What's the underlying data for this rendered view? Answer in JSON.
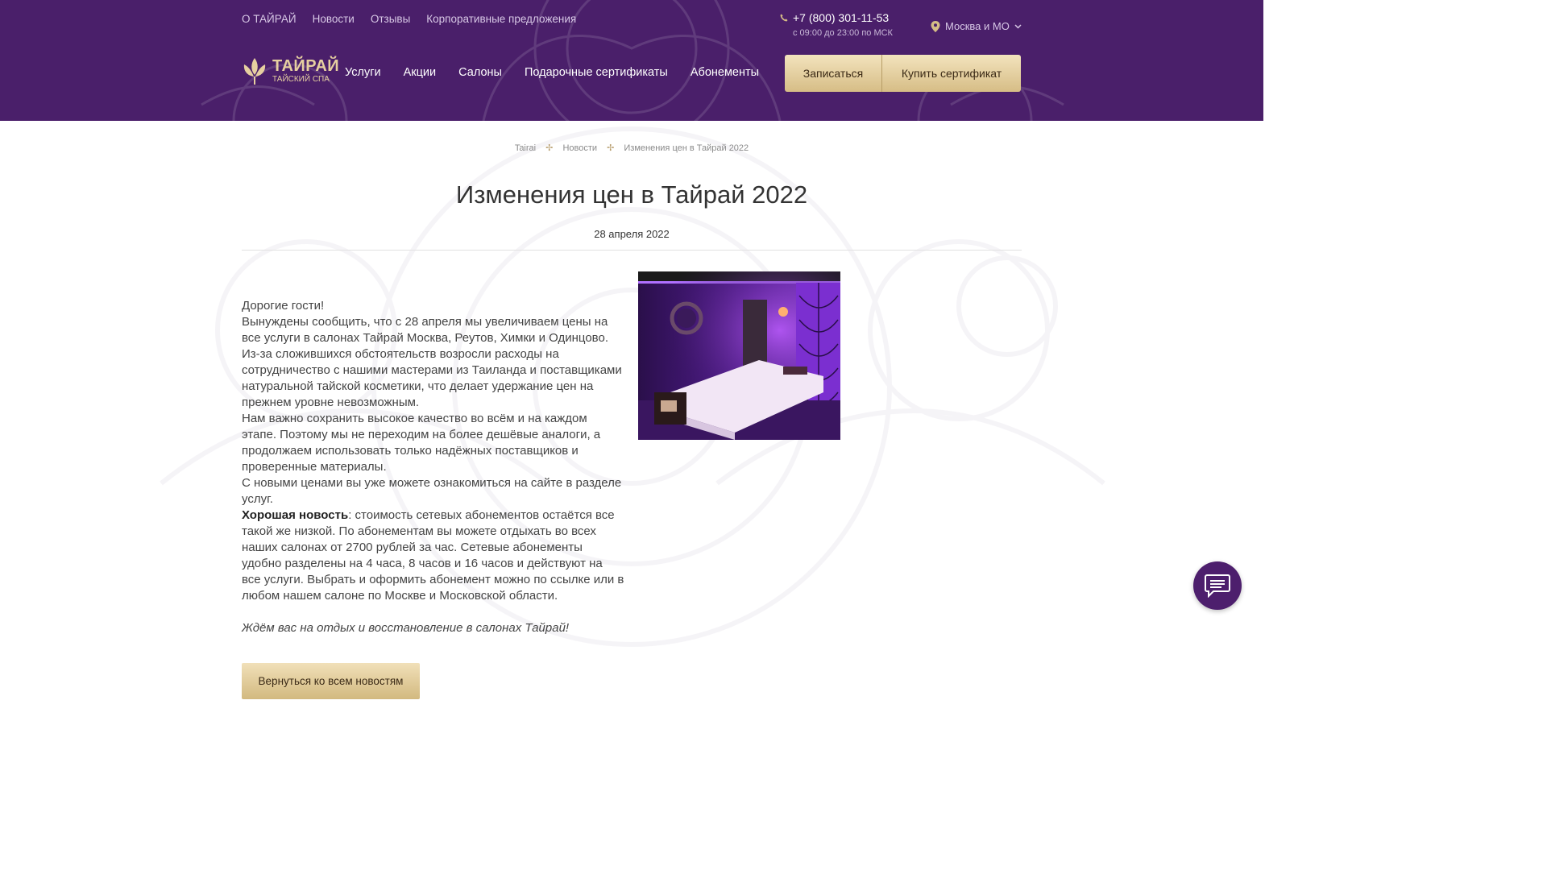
{
  "header": {
    "top_links": [
      "О ТАЙРАЙ",
      "Новости",
      "Отзывы",
      "Корпоративные предложения"
    ],
    "phone": "+7 (800) 301-11-53",
    "phone_hours": "с 09:00 до 23:00 по МСК",
    "region": "Москва и МО",
    "logo_title": "ТАЙРАЙ",
    "logo_subtitle": "ТАЙСКИЙ СПА",
    "main_nav": [
      "Услуги",
      "Акции",
      "Салоны",
      "Подарочные сертификаты",
      "Абонементы"
    ],
    "signup_label": "Записаться",
    "buy_cert_label": "Купить сертификат"
  },
  "breadcrumb": [
    "Tairai",
    "Новости",
    "Изменения цен в Тайрай 2022"
  ],
  "article": {
    "title": "Изменения цен в Тайрай 2022",
    "date": "28 апреля 2022",
    "greeting": "Дорогие гости!",
    "p1": "Вынуждены сообщить, что с 28 апреля мы увеличиваем цены на все услуги в салонах Тайрай Москва, Реутов, Химки и Одинцово. Из-за сложившихся обстоятельств возросли расходы на сотрудничество с нашими мастерами из Таиланда и поставщиками натуральной тайской косметики, что делает удержание цен на прежнем уровне невозможным.",
    "p2": "Нам важно сохранить высокое качество во всём и на каждом этапе. Поэтому мы не переходим на более дешёвые аналоги, а продолжаем использовать только надёжных поставщиков и проверенные материалы.",
    "p3": "С новыми ценами вы уже можете ознакомиться на сайте в разделе услуг.",
    "good_news_label": "Хорошая новость",
    "p4": ": стоимость сетевых абонементов остаётся все такой же низкой. По абонементам вы можете отдыхать во всех наших салонах от 2700 рублей за час. Сетевые абонементы удобно разделены на 4 часа, 8 часов и 16 часов и действуют на все услуги. Выбрать и оформить абонемент можно по ссылке или в любом нашем салоне по Москве и Московской области.",
    "closing": "Ждём вас на отдых и восстановление в салонах Тайрай!",
    "back_label": "Вернуться ко всем новостям"
  },
  "colors": {
    "header_bg": "#4a1f6a",
    "gold": "#d6bd86",
    "chat_bg": "#4d1f6d"
  },
  "icons": [
    "phone-icon",
    "location-pin-icon",
    "chevron-down-icon",
    "lotus-logo-icon",
    "chat-icon"
  ]
}
